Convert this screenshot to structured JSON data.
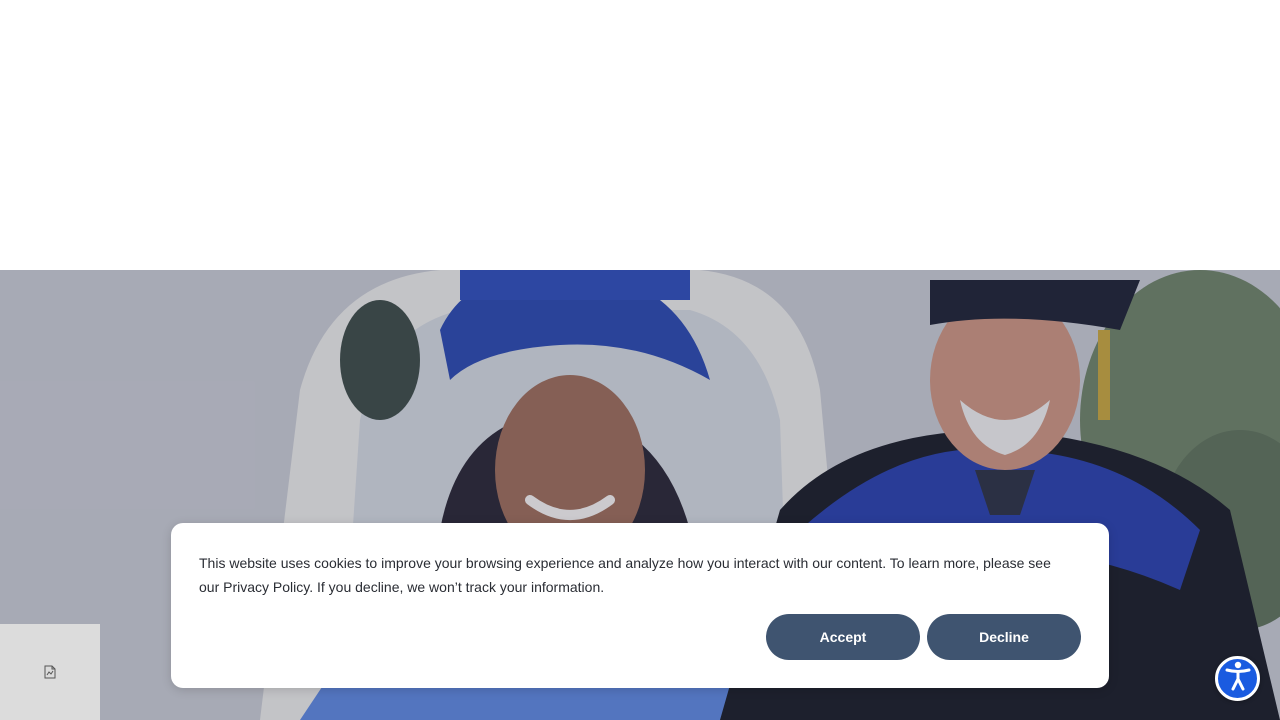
{
  "cookie_banner": {
    "message": "This website uses cookies to improve your browsing experience and analyze how you interact with our content. To learn more, please see our Privacy Policy. If you decline, we won’t track your information.",
    "accept_label": "Accept",
    "decline_label": "Decline"
  },
  "hero": {
    "image_subject": "graduates-in-caps-and-gowns"
  },
  "icons": {
    "side_widget": "document-icon",
    "accessibility": "accessibility-icon"
  },
  "colors": {
    "button_bg": "#3f5470",
    "button_text": "#ffffff",
    "accessibility_bg": "#1a5be0",
    "side_widget_bg": "#dcdcdc",
    "banner_bg": "#ffffff"
  }
}
